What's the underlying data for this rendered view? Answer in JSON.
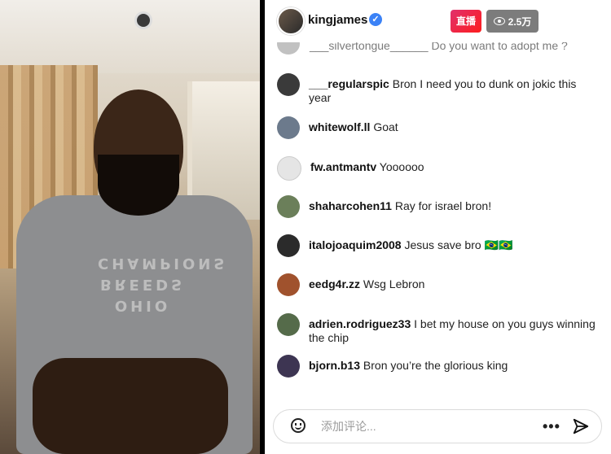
{
  "header": {
    "username": "kingjames",
    "verified": "✓",
    "live_label": "直播",
    "viewer_count": "2.5万"
  },
  "partial_comment": {
    "text": "___silvertongue______ Do you want to adopt me ?"
  },
  "comments": [
    {
      "user": "___regularspic",
      "text": "Bron I need you to dunk on jokic this year",
      "avatar_color": "#3a3a3a"
    },
    {
      "user": "whitewolf.ll",
      "text": "Goat",
      "avatar_color": "#6c7a8c"
    },
    {
      "user": "fw.antmantv",
      "text": "Yoooooo",
      "avatar_color": "#e5e5e5"
    },
    {
      "user": "shaharcohen11",
      "text": "Ray for israel bron!",
      "avatar_color": "#6b7f5a"
    },
    {
      "user": "italojoaquim2008",
      "text": "Jesus save bro 🇧🇷🇧🇷",
      "avatar_color": "#2b2b2b"
    },
    {
      "user": "eedg4r.zz",
      "text": "Wsg Lebron",
      "avatar_color": "#a0522d"
    },
    {
      "user": "adrien.rodriguez33",
      "text": "I bet my house on you guys winning the chip",
      "avatar_color": "#556b4a"
    },
    {
      "user": "bjorn.b13",
      "text": "Bron you’re the glorious king",
      "avatar_color": "#3d3552"
    }
  ],
  "footer": {
    "placeholder": "添加评论...",
    "more": "•••"
  },
  "video": {
    "shirt_text": "OHIO\nBREEDS\nCHAMPIONS"
  }
}
